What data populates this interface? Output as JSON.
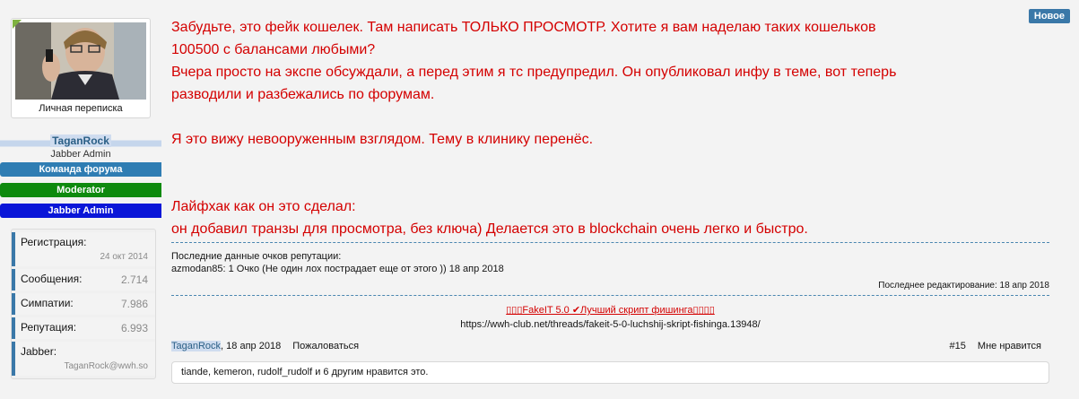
{
  "user": {
    "pm_label": "Личная переписка",
    "username": "TaganRock",
    "user_title": "Jabber Admin",
    "banners": [
      "Команда форума",
      "Moderator",
      "Jabber Admin"
    ],
    "banner_colors": [
      "#2f7db3",
      "#0e8a0e",
      "#0a16d8"
    ],
    "online_color": "#7fb240"
  },
  "stats": {
    "registration_label": "Регистрация:",
    "registration_value": "24 окт 2014",
    "messages_label": "Сообщения:",
    "messages_value": "2.714",
    "likes_label": "Симпатии:",
    "likes_value": "7.986",
    "reputation_label": "Репутация:",
    "reputation_value": "6.993",
    "jabber_label": "Jabber:",
    "jabber_value": "TaganRock@wwh.so"
  },
  "post": {
    "new_badge": "Новое",
    "message_lines": [
      "Забудьте, это фейк кошелек. Там написать ТОЛЬКО ПРОСМОТР. Хотите я вам наделаю таких кошельков",
      "100500 с балансами любыми?",
      "Вчера просто на экспе обсуждали, а перед этим я тс предупредил. Он опубликовал инфу в теме, вот теперь",
      "разводили и разбежались по форумам.",
      "",
      "Я это вижу невооруженным взглядом. Тему в клинику перенёс.",
      "",
      "",
      "Лайфхак как он это сделал:",
      "он добавил транзы для просмотра, без ключа) Делается это в blockchain очень легко и быстро."
    ],
    "message_color": "#d40000",
    "rep_header": "Последние данные очков репутации:",
    "rep_entry": "azmodan85: 1 Очко (Не один лох пострадает еще от этого )) 18 апр 2018",
    "edited": "Последнее редактирование: 18 апр 2018",
    "signature_link": "▯▯▯FakeIT 5.0 ✔Лучший скрипт фишинга▯▯▯▯",
    "signature_url": "https://wwh-club.net/threads/fakeit-5-0-luchshij-skript-fishinga.13948/",
    "footer_author": "TaganRock",
    "footer_date": "18 апр 2018",
    "report_label": "Пожаловаться",
    "post_number": "#15",
    "like_label": "Мне нравится",
    "likes_summary": "tiande, kemeron, rudolf_rudolf и 6 другим нравится это."
  }
}
